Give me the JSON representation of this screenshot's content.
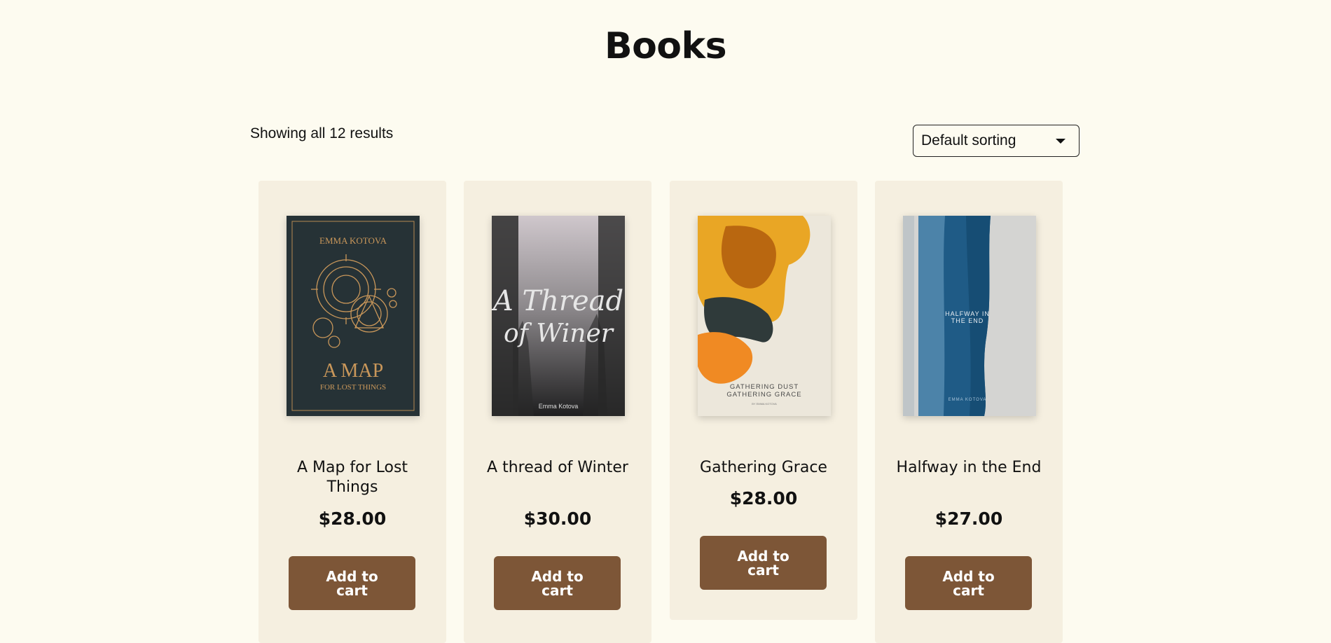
{
  "page": {
    "title": "Books"
  },
  "toolbar": {
    "result_count": "Showing all 12 results",
    "sort": {
      "selected": "Default sorting"
    }
  },
  "products": [
    {
      "title": "A Map for Lost Things",
      "price": "$28.00",
      "button": "Add to cart",
      "cover": {
        "author": "EMMA KOTOVA",
        "line1": "A MAP",
        "line2": "FOR LOST THINGS"
      }
    },
    {
      "title": "A thread of Winter",
      "price": "$30.00",
      "button": "Add to cart",
      "cover": {
        "line1": "A Thread",
        "line2": "of Winer",
        "author": "Emma Kotova"
      }
    },
    {
      "title": "Gathering Grace",
      "price": "$28.00",
      "button": "Add to cart",
      "cover": {
        "line1": "GATHERING DUST",
        "line2": "GATHERING GRACE",
        "author": "BY EMMA KOTOVA"
      }
    },
    {
      "title": "Halfway in the End",
      "price": "$27.00",
      "button": "Add to cart",
      "cover": {
        "line1": "HALFWAY IN",
        "line2": "THE END",
        "author": "EMMA KOTOVA"
      }
    }
  ],
  "colors": {
    "background": "#fdfbf0",
    "card": "#f5efe0",
    "button": "#7d5637",
    "button_text": "#ffffff"
  }
}
